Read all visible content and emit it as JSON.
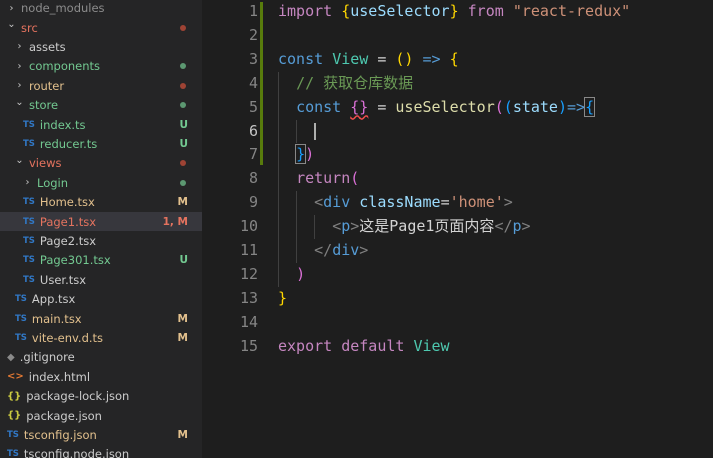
{
  "explorer": {
    "items": [
      {
        "label": "node_modules",
        "kind": "folder-closed",
        "indent": 0,
        "color": "dim",
        "badge": "",
        "dot": ""
      },
      {
        "label": "src",
        "kind": "folder-open",
        "indent": 0,
        "color": "red",
        "badge": "",
        "dot": "red"
      },
      {
        "label": "assets",
        "kind": "folder-closed",
        "indent": 1,
        "color": "normal",
        "badge": "",
        "dot": ""
      },
      {
        "label": "components",
        "kind": "folder-closed",
        "indent": 1,
        "color": "green",
        "badge": "",
        "dot": "green"
      },
      {
        "label": "router",
        "kind": "folder-closed",
        "indent": 1,
        "color": "mod",
        "badge": "",
        "dot": "red"
      },
      {
        "label": "store",
        "kind": "folder-open",
        "indent": 1,
        "color": "green",
        "badge": "",
        "dot": "green"
      },
      {
        "label": "index.ts",
        "kind": "ts",
        "indent": 2,
        "color": "green",
        "badge": "U",
        "dot": ""
      },
      {
        "label": "reducer.ts",
        "kind": "ts",
        "indent": 2,
        "color": "green",
        "badge": "U",
        "dot": ""
      },
      {
        "label": "views",
        "kind": "folder-open",
        "indent": 1,
        "color": "red",
        "badge": "",
        "dot": "red"
      },
      {
        "label": "Login",
        "kind": "folder-closed",
        "indent": 2,
        "color": "green",
        "badge": "",
        "dot": "green"
      },
      {
        "label": "Home.tsx",
        "kind": "ts",
        "indent": 2,
        "color": "mod",
        "badge": "M",
        "dot": ""
      },
      {
        "label": "Page1.tsx",
        "kind": "ts",
        "indent": 2,
        "color": "red",
        "badge": "1, M",
        "dot": "",
        "selected": true
      },
      {
        "label": "Page2.tsx",
        "kind": "ts",
        "indent": 2,
        "color": "normal",
        "badge": "",
        "dot": ""
      },
      {
        "label": "Page301.tsx",
        "kind": "ts",
        "indent": 2,
        "color": "green",
        "badge": "U",
        "dot": ""
      },
      {
        "label": "User.tsx",
        "kind": "ts",
        "indent": 2,
        "color": "normal",
        "badge": "",
        "dot": ""
      },
      {
        "label": "App.tsx",
        "kind": "ts",
        "indent": 1,
        "color": "normal",
        "badge": "",
        "dot": ""
      },
      {
        "label": "main.tsx",
        "kind": "ts",
        "indent": 1,
        "color": "mod",
        "badge": "M",
        "dot": ""
      },
      {
        "label": "vite-env.d.ts",
        "kind": "ts",
        "indent": 1,
        "color": "mod",
        "badge": "M",
        "dot": ""
      },
      {
        "label": ".gitignore",
        "kind": "git",
        "indent": 0,
        "color": "normal",
        "badge": "",
        "dot": ""
      },
      {
        "label": "index.html",
        "kind": "html",
        "indent": 0,
        "color": "normal",
        "badge": "",
        "dot": ""
      },
      {
        "label": "package-lock.json",
        "kind": "json",
        "indent": 0,
        "color": "normal",
        "badge": "",
        "dot": ""
      },
      {
        "label": "package.json",
        "kind": "json",
        "indent": 0,
        "color": "normal",
        "badge": "",
        "dot": ""
      },
      {
        "label": "tsconfig.json",
        "kind": "tsconfig",
        "indent": 0,
        "color": "mod",
        "badge": "M",
        "dot": ""
      },
      {
        "label": "tsconfig.node.json",
        "kind": "tsconfig",
        "indent": 0,
        "color": "normal",
        "badge": "",
        "dot": ""
      }
    ],
    "icons": {
      "ts": "TS",
      "json": "{}",
      "html": "<>",
      "git": "◆",
      "chev_open": "⌄",
      "chev_closed": "›"
    }
  },
  "editor": {
    "active_line": 6,
    "lines": [
      {
        "n": "1",
        "tokens": [
          [
            "kw2",
            "import "
          ],
          [
            "br1",
            "{"
          ],
          [
            "var",
            "useSelector"
          ],
          [
            "br1",
            "}"
          ],
          [
            "kw2",
            " from "
          ],
          [
            "str",
            "\"react-redux\""
          ]
        ]
      },
      {
        "n": "2",
        "tokens": []
      },
      {
        "n": "3",
        "tokens": [
          [
            "kw",
            "const "
          ],
          [
            "cls",
            "View"
          ],
          [
            "txt",
            " = "
          ],
          [
            "br1",
            "()"
          ],
          [
            "txt",
            " "
          ],
          [
            "kw",
            "=>"
          ],
          [
            "txt",
            " "
          ],
          [
            "br1",
            "{"
          ]
        ]
      },
      {
        "n": "4",
        "tokens": [
          [
            "txt",
            "  "
          ],
          [
            "cmt",
            "// 获取仓库数据"
          ]
        ]
      },
      {
        "n": "5",
        "tokens": [
          [
            "txt",
            "  "
          ],
          [
            "kw",
            "const "
          ],
          [
            "br2 squiggle",
            "{}"
          ],
          [
            "txt",
            " = "
          ],
          [
            "fn",
            "useSelector"
          ],
          [
            "br2",
            "("
          ],
          [
            "br3",
            "("
          ],
          [
            "var",
            "state"
          ],
          [
            "br3",
            ")"
          ],
          [
            "kw",
            "=>"
          ],
          [
            "br3 bracket-box",
            "{"
          ]
        ]
      },
      {
        "n": "6",
        "tokens": []
      },
      {
        "n": "7",
        "tokens": [
          [
            "txt",
            "  "
          ],
          [
            "br3 bracket-box",
            "}"
          ],
          [
            "br2",
            ")"
          ]
        ]
      },
      {
        "n": "8",
        "tokens": [
          [
            "txt",
            "  "
          ],
          [
            "kw2",
            "return"
          ],
          [
            "br2",
            "("
          ]
        ]
      },
      {
        "n": "9",
        "tokens": [
          [
            "txt",
            "    "
          ],
          [
            "tagp",
            "<"
          ],
          [
            "tag",
            "div"
          ],
          [
            "txt",
            " "
          ],
          [
            "var",
            "className"
          ],
          [
            "txt",
            "="
          ],
          [
            "str",
            "'home'"
          ],
          [
            "tagp",
            ">"
          ]
        ]
      },
      {
        "n": "10",
        "tokens": [
          [
            "txt",
            "      "
          ],
          [
            "tagp",
            "<"
          ],
          [
            "tag",
            "p"
          ],
          [
            "tagp",
            ">"
          ],
          [
            "txt",
            "这是Page1页面内容"
          ],
          [
            "tagp",
            "</"
          ],
          [
            "tag",
            "p"
          ],
          [
            "tagp",
            ">"
          ]
        ]
      },
      {
        "n": "11",
        "tokens": [
          [
            "txt",
            "    "
          ],
          [
            "tagp",
            "</"
          ],
          [
            "tag",
            "div"
          ],
          [
            "tagp",
            ">"
          ]
        ]
      },
      {
        "n": "12",
        "tokens": [
          [
            "txt",
            "  "
          ],
          [
            "br2",
            ")"
          ]
        ]
      },
      {
        "n": "13",
        "tokens": [
          [
            "br1",
            "}"
          ]
        ]
      },
      {
        "n": "14",
        "tokens": []
      },
      {
        "n": "15",
        "tokens": [
          [
            "kw2",
            "export "
          ],
          [
            "kw2",
            "default "
          ],
          [
            "cls",
            "View"
          ]
        ]
      }
    ]
  }
}
